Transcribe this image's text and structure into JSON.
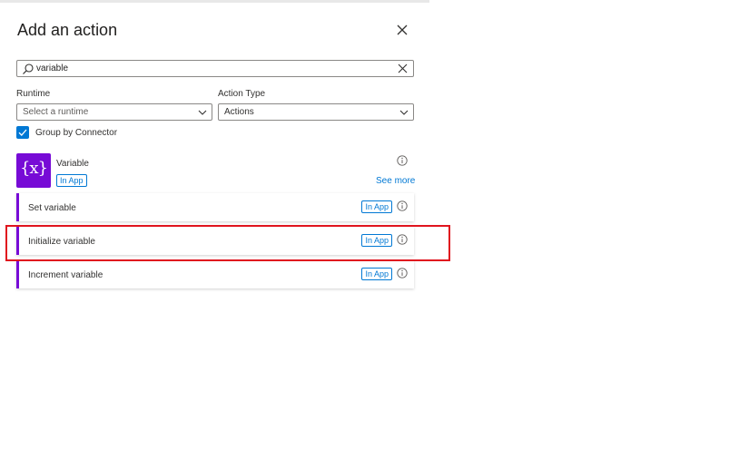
{
  "panel": {
    "title": "Add an action",
    "close_icon": "close-icon"
  },
  "search": {
    "value": "variable",
    "icon": "search-icon",
    "clear_icon": "clear-icon"
  },
  "filters": {
    "runtime": {
      "label": "Runtime",
      "placeholder": "Select a runtime"
    },
    "action_type": {
      "label": "Action Type",
      "value": "Actions"
    }
  },
  "group_by_connector": {
    "label": "Group by Connector",
    "checked": true
  },
  "connector": {
    "name": "Variable",
    "icon_glyph": "{x}",
    "badge": "In App",
    "see_more": "See more"
  },
  "actions": [
    {
      "label": "Set variable",
      "badge": "In App"
    },
    {
      "label": "Initialize variable",
      "badge": "In App",
      "highlighted": true
    },
    {
      "label": "Increment variable",
      "badge": "In App"
    }
  ],
  "colors": {
    "accent": "#0078d4",
    "connector": "#770bd6",
    "highlight": "#e0141e"
  }
}
